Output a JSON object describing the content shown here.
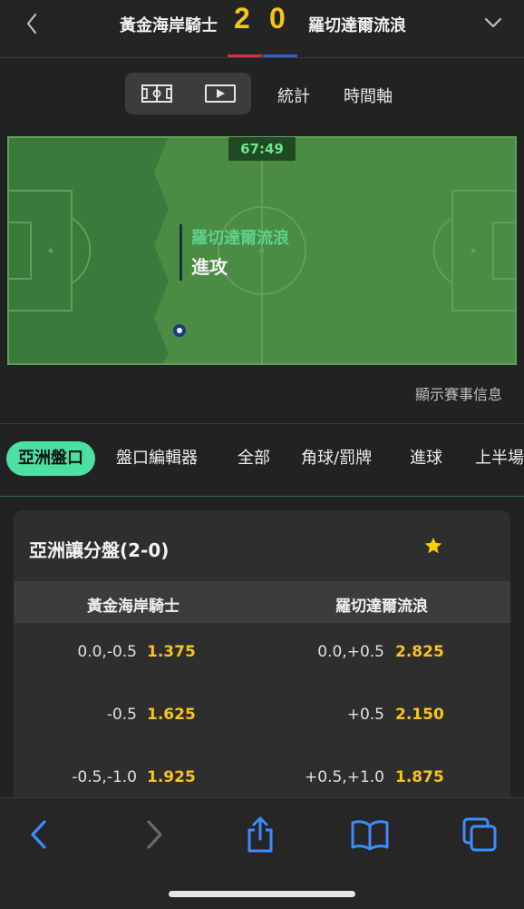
{
  "header": {
    "home_team": "黃金海岸騎士",
    "away_team": "羅切達爾流浪",
    "home_score": "2",
    "away_score": "0",
    "home_color": "#d9303a",
    "away_color": "#3a5bd9",
    "back_icon": "chevron-left-icon",
    "expand_icon": "chevron-down-icon"
  },
  "view_toggle": {
    "field_icon": "pitch-icon",
    "video_icon": "play-video-icon",
    "stats_label": "統計",
    "timeline_label": "時間軸"
  },
  "pitch": {
    "clock": "67:49",
    "attacking_team": "羅切達爾流浪",
    "event": "進攻",
    "show_info": "顯示賽事信息"
  },
  "tabs": [
    {
      "label": "亞洲盤口",
      "active": true
    },
    {
      "label": "盤口編輯器",
      "active": false
    },
    {
      "label": "全部",
      "active": false
    },
    {
      "label": "角球/罰牌",
      "active": false
    },
    {
      "label": "進球",
      "active": false
    },
    {
      "label": "上半場",
      "active": false
    }
  ],
  "market": {
    "title": "亞洲讓分盤(2-0)",
    "favorite_icon": "star-icon",
    "columns": [
      "黃金海岸騎士",
      "羅切達爾流浪"
    ],
    "rows": [
      {
        "home_line": "0.0,-0.5",
        "home_price": "1.375",
        "away_line": "0.0,+0.5",
        "away_price": "2.825"
      },
      {
        "home_line": "-0.5",
        "home_price": "1.625",
        "away_line": "+0.5",
        "away_price": "2.150"
      },
      {
        "home_line": "-0.5,-1.0",
        "home_price": "1.925",
        "away_line": "+0.5,+1.0",
        "away_price": "1.875"
      }
    ]
  },
  "toolbar": {
    "back_icon": "chevron-left-icon",
    "forward_icon": "chevron-right-icon",
    "share_icon": "share-icon",
    "bookmarks_icon": "book-icon",
    "tabs_icon": "tabs-icon"
  },
  "colors": {
    "accent": "#4de0a3",
    "odds": "#f5c518",
    "pitch_dark": "#3a7a3a",
    "pitch_light": "#4b8c45"
  }
}
